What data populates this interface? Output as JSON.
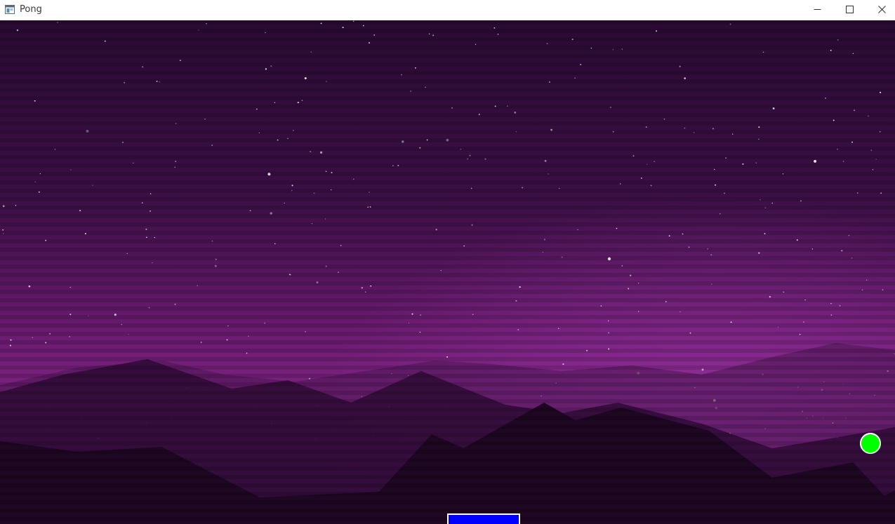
{
  "window": {
    "title": "Pong",
    "icon": "app-window-icon",
    "controls": {
      "minimize_icon": "minimize-icon",
      "maximize_icon": "maximize-icon",
      "close_icon": "close-icon"
    }
  },
  "game": {
    "background": "starry-purple-night-mountains",
    "colors": {
      "ball": "#00ff00",
      "ball_outline": "#ffffff",
      "paddle": "#0000ff",
      "paddle_outline": "#ffffff",
      "sky_top": "#260a2e",
      "sky_glow": "#7a1f7e",
      "mountains_far": "#3e1144",
      "mountains_near": "#1b0620"
    }
  }
}
